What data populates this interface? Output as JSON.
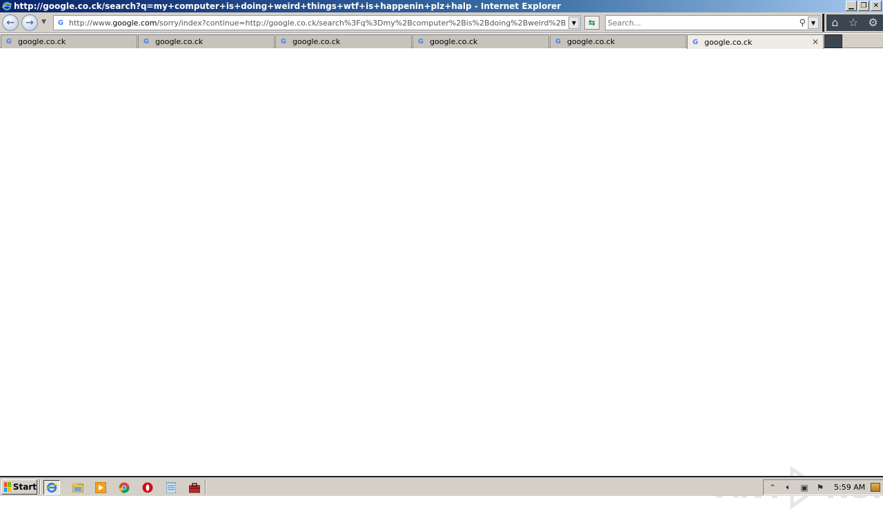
{
  "window": {
    "title": "http://google.co.ck/search?q=my+computer+is+doing+weird+things+wtf+is+happenin+plz+halp - Internet Explorer",
    "controls": {
      "minimize": "▁",
      "restore": "❐",
      "close": "✕"
    }
  },
  "toolbar": {
    "address_prefix": "http://www.",
    "address_host": "google.com",
    "address_rest": "/sorry/index?continue=http://google.co.ck/search%3Fq%3Dmy%2Bcomputer%2Bis%2Bdoing%2Bweird%2Bthings%2Bwtf%",
    "search_placeholder": "Search...",
    "icons": [
      "back-icon",
      "forward-icon",
      "refresh-icon",
      "search-icon",
      "home-icon",
      "favorites-star-icon",
      "settings-gear-icon"
    ]
  },
  "tabs": [
    {
      "label": "google.co.ck",
      "active": false
    },
    {
      "label": "google.co.ck",
      "active": false
    },
    {
      "label": "google.co.ck",
      "active": false
    },
    {
      "label": "google.co.ck",
      "active": false
    },
    {
      "label": "google.co.ck",
      "active": false
    },
    {
      "label": "google.co.ck",
      "active": true
    }
  ],
  "watermark": {
    "left": "ANY",
    "right": "RUN"
  },
  "taskbar": {
    "start_label": "Start",
    "apps": [
      "internet-explorer-icon",
      "file-explorer-icon",
      "media-player-icon",
      "chrome-icon",
      "opera-icon",
      "notepad-icon",
      "toolbox-icon"
    ],
    "clock": "5:59 AM"
  },
  "colors": {
    "accent": "#0a246a",
    "chrome": "#d4d0c8"
  }
}
